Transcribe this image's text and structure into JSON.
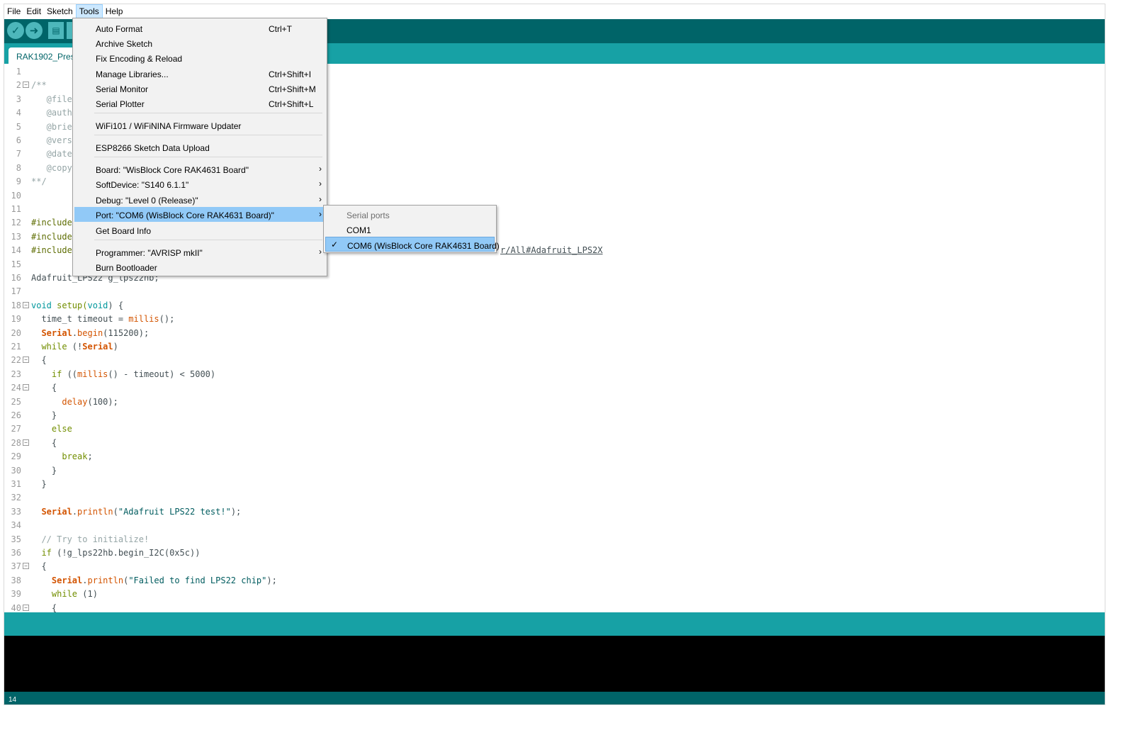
{
  "menubar": [
    "File",
    "Edit",
    "Sketch",
    "Tools",
    "Help"
  ],
  "toolbar": {
    "verify_icon": "check-icon",
    "upload_icon": "arrow-right-icon",
    "new_icon": "document-icon"
  },
  "tab": {
    "label": "RAK1902_Pres"
  },
  "tools_menu": {
    "items": [
      {
        "label": "Auto Format",
        "shortcut": "Ctrl+T"
      },
      {
        "label": "Archive Sketch",
        "shortcut": ""
      },
      {
        "label": "Fix Encoding & Reload",
        "shortcut": ""
      },
      {
        "label": "Manage Libraries...",
        "shortcut": "Ctrl+Shift+I"
      },
      {
        "label": "Serial Monitor",
        "shortcut": "Ctrl+Shift+M"
      },
      {
        "label": "Serial Plotter",
        "shortcut": "Ctrl+Shift+L"
      },
      {
        "label": "WiFi101 / WiFiNINA Firmware Updater",
        "shortcut": ""
      },
      {
        "label": "ESP8266 Sketch Data Upload",
        "shortcut": ""
      },
      {
        "label": "Board: \"WisBlock Core RAK4631 Board\"",
        "shortcut": ""
      },
      {
        "label": "SoftDevice: \"S140 6.1.1\"",
        "shortcut": ""
      },
      {
        "label": "Debug: \"Level 0 (Release)\"",
        "shortcut": ""
      },
      {
        "label": "Port: \"COM6 (WisBlock Core RAK4631 Board)\"",
        "shortcut": ""
      },
      {
        "label": "Get Board Info",
        "shortcut": ""
      },
      {
        "label": "Programmer: \"AVRISP mkII\"",
        "shortcut": ""
      },
      {
        "label": "Burn Bootloader",
        "shortcut": ""
      }
    ]
  },
  "port_submenu": {
    "header": "Serial ports",
    "items": [
      "COM1",
      "COM6 (WisBlock Core RAK4631 Board)"
    ],
    "selected": "COM6 (WisBlock Core RAK4631 Board)"
  },
  "editor": {
    "line_numbers": [
      "1",
      "2",
      "3",
      "4",
      "5",
      "6",
      "7",
      "8",
      "9",
      "10",
      "11",
      "12",
      "13",
      "14",
      "15",
      "16",
      "17",
      "18",
      "19",
      "20",
      "21",
      "22",
      "23",
      "24",
      "25",
      "26",
      "27",
      "28",
      "29",
      "30",
      "31",
      "32",
      "33",
      "34",
      "35",
      "36",
      "37",
      "38",
      "39",
      "40"
    ],
    "visible_fragments": {
      "l2": "/**",
      "l3": "   @file",
      "l4": "   @auth",
      "l5": "   @brie",
      "l6": "   @vers",
      "l7": "   @date",
      "l8": "   @copy",
      "l9": "**/",
      "l12": "#include",
      "l13": "#include",
      "l14": "#include",
      "l14_link": "r/All#Adafruit_LPS2X",
      "l16": "Adafruit_LPS22 g_lps22hb;",
      "l18a": "void",
      "l18b": " setup(",
      "l18c": "void",
      "l18d": ") {",
      "l19a": "  time_t timeout = ",
      "l19b": "millis",
      "l19c": "();",
      "l20a": "  ",
      "l20b": "Serial",
      "l20c": ".",
      "l20d": "begin",
      "l20e": "(115200);",
      "l21a": "  ",
      "l21b": "while",
      "l21c": " (!",
      "l21d": "Serial",
      "l21e": ")",
      "l22": "  {",
      "l23a": "    ",
      "l23b": "if",
      "l23c": " ((",
      "l23d": "millis",
      "l23e": "() - timeout) < 5000)",
      "l24": "    {",
      "l25a": "      ",
      "l25b": "delay",
      "l25c": "(100);",
      "l26": "    }",
      "l27a": "    ",
      "l27b": "else",
      "l28": "    {",
      "l29a": "      ",
      "l29b": "break",
      "l29c": ";",
      "l30": "    }",
      "l31": "  }",
      "l33a": "  ",
      "l33b": "Serial",
      "l33c": ".",
      "l33d": "println",
      "l33e": "(",
      "l33f": "\"Adafruit LPS22 test!\"",
      "l33g": ");",
      "l35": "  // Try to initialize!",
      "l36a": "  ",
      "l36b": "if",
      "l36c": " (!g_lps22hb.begin_I2C(0x5c))",
      "l37": "  {",
      "l38a": "    ",
      "l38b": "Serial",
      "l38c": ".",
      "l38d": "println",
      "l38e": "(",
      "l38f": "\"Failed to find LPS22 chip\"",
      "l38g": ");",
      "l39a": "    ",
      "l39b": "while",
      "l39c": " (1)",
      "l40": "    {"
    }
  },
  "footer": {
    "line": "14"
  },
  "colors": {
    "toolbar": "#006468",
    "tabstrip": "#17a1a5",
    "highlight": "#91c9f7"
  }
}
